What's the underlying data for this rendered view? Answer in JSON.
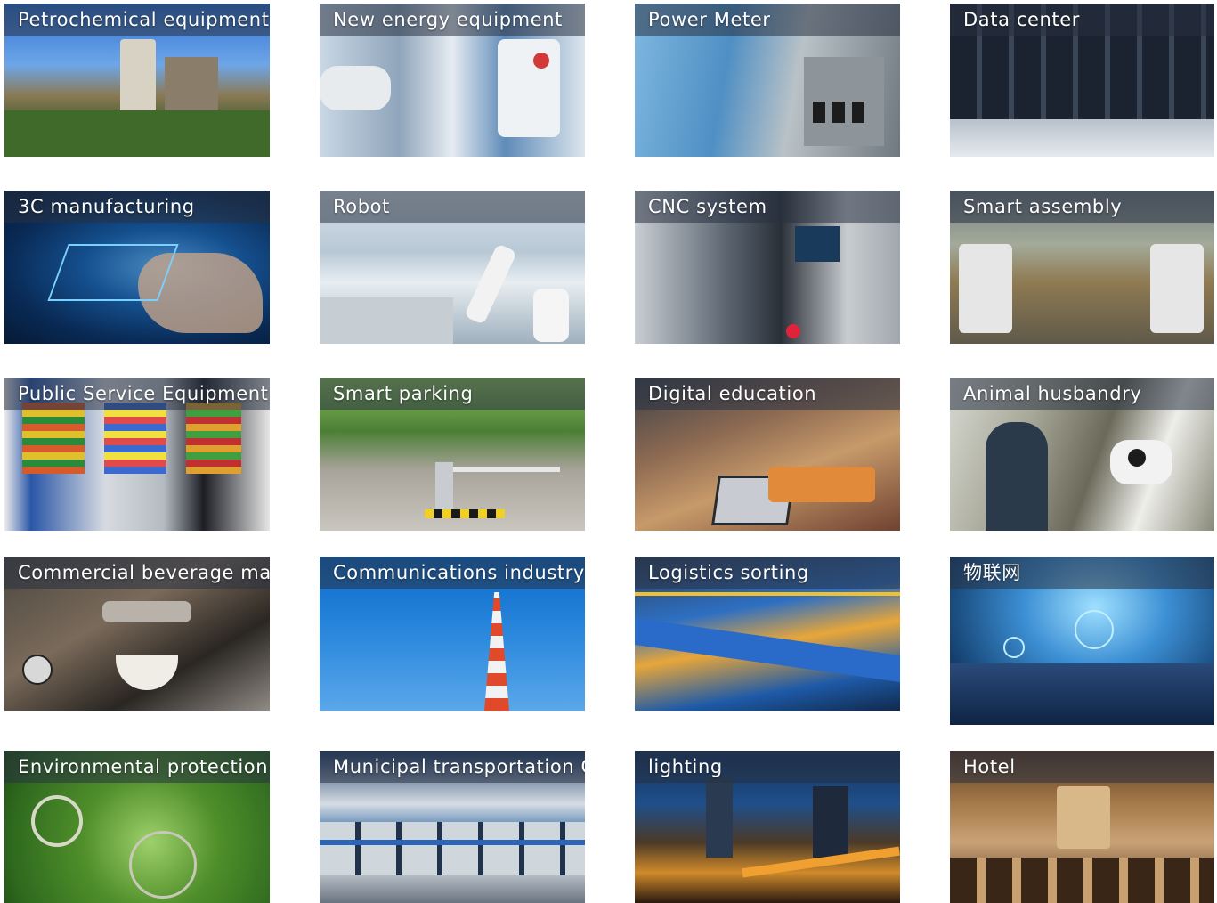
{
  "tiles": [
    {
      "label": "Petrochemical equipment"
    },
    {
      "label": "New energy equipment"
    },
    {
      "label": "Power Meter"
    },
    {
      "label": "Data center"
    },
    {
      "label": "3C manufacturing"
    },
    {
      "label": "Robot"
    },
    {
      "label": "CNC system"
    },
    {
      "label": "Smart assembly"
    },
    {
      "label": "Public Service Equipment"
    },
    {
      "label": "Smart parking"
    },
    {
      "label": "Digital education"
    },
    {
      "label": "Animal husbandry"
    },
    {
      "label": "Commercial beverage machine"
    },
    {
      "label": "Communications industry"
    },
    {
      "label": "Logistics sorting"
    },
    {
      "label": "物联网"
    },
    {
      "label": "Environmental protection industry"
    },
    {
      "label": "Municipal transportation City"
    },
    {
      "label": "lighting"
    },
    {
      "label": "Hotel"
    }
  ]
}
